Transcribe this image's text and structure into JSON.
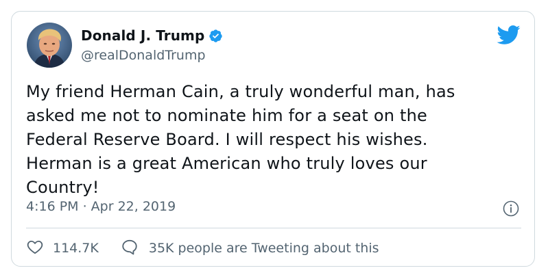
{
  "author": {
    "display_name": "Donald J. Trump",
    "handle": "@realDonaldTrump",
    "verified": true,
    "avatar_icon": "profile-photo"
  },
  "tweet": {
    "text": "My friend Herman Cain, a truly wonderful man, has\nasked me not to nominate him for a seat on the\nFederal Reserve Board. I will respect his wishes.\nHerman is a great American who truly loves our\nCountry!",
    "timestamp": "4:16 PM · Apr 22, 2019"
  },
  "actions": {
    "like_count": "114.7K",
    "conversation_text": "35K people are Tweeting about this"
  },
  "icons": {
    "brand": "twitter-bird-icon",
    "verified": "verified-badge-icon",
    "info": "info-icon",
    "like": "heart-icon",
    "reply": "speech-bubble-icon"
  },
  "colors": {
    "brand_blue": "#1d9bf0",
    "text_primary": "#0f1419",
    "text_secondary": "#536471",
    "border": "#cfd9de"
  }
}
